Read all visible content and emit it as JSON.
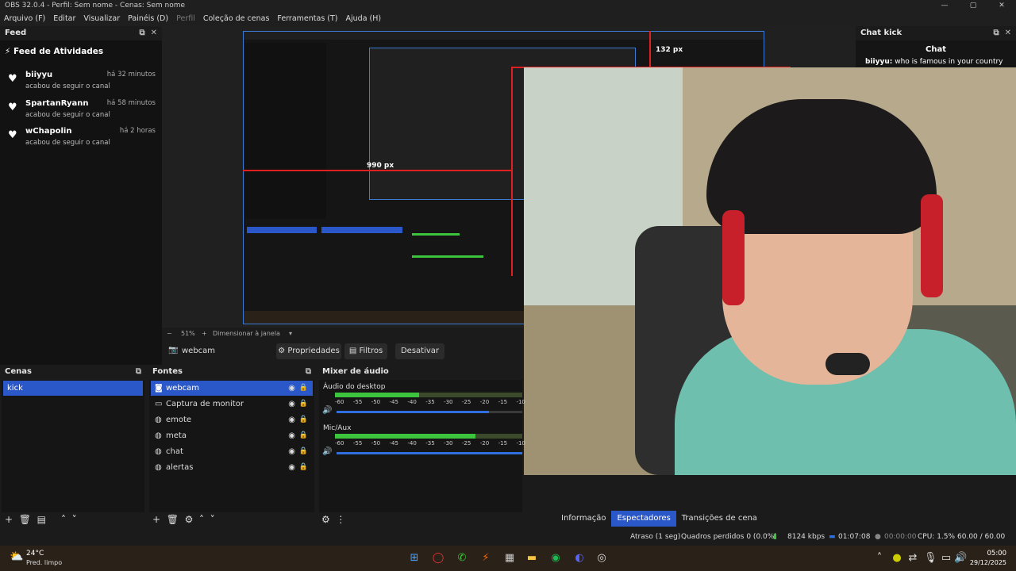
{
  "window": {
    "title": "OBS 32.0.4 - Perfil: Sem nome - Cenas: Sem nome",
    "minimize": "—",
    "maximize": "▢",
    "close": "✕"
  },
  "menu": [
    "Arquivo (F)",
    "Editar",
    "Visualizar",
    "Painéis (D)",
    "Perfil",
    "Coleção de cenas",
    "Ferramentas (T)",
    "Ajuda (H)"
  ],
  "feed": {
    "dock_title": "Feed",
    "heading": "Feed de Atividades",
    "items": [
      {
        "name": "biiyyu",
        "time": "há 32 minutos",
        "action": "acabou de seguir o canal"
      },
      {
        "name": "SpartanRyann",
        "time": "há 58 minutos",
        "action": "acabou de seguir o canal"
      },
      {
        "name": "wChapolin",
        "time": "há 2 horas",
        "action": "acabou de seguir o canal"
      }
    ]
  },
  "chat": {
    "dock_title": "Chat kick",
    "heading": "Chat",
    "messages": [
      {
        "user": "biiyyu:",
        "text": "who is famous in your country"
      }
    ]
  },
  "overlay": {
    "label_top": "132 px",
    "label_left": "990 px"
  },
  "zoom": {
    "minus": "−",
    "value": "51%",
    "plus": "+",
    "mode": "Dimensionar à janela"
  },
  "source_bar": {
    "source": "webcam",
    "properties": "Propriedades",
    "filters": "Filtros",
    "deactivate": "Desativar"
  },
  "scenes": {
    "title": "Cenas",
    "items": [
      "kick"
    ]
  },
  "sources": {
    "title": "Fontes",
    "items": [
      {
        "label": "webcam",
        "icon": "camera-icon"
      },
      {
        "label": "Captura de monitor",
        "icon": "monitor-icon"
      },
      {
        "label": "emote",
        "icon": "globe-icon"
      },
      {
        "label": "meta",
        "icon": "globe-icon"
      },
      {
        "label": "chat",
        "icon": "globe-icon"
      },
      {
        "label": "alertas",
        "icon": "globe-icon"
      }
    ]
  },
  "mixer": {
    "title": "Mixer de áudio",
    "channels": [
      {
        "name": "Áudio do desktop",
        "level": 0.45,
        "volume": 0.82
      },
      {
        "name": "Mic/Aux",
        "level": 0.75,
        "volume": 1.0
      }
    ],
    "scale": [
      "-60",
      "-55",
      "-50",
      "-45",
      "-40",
      "-35",
      "-30",
      "-25",
      "-20",
      "-15",
      "-10"
    ]
  },
  "tabs": [
    "Informação",
    "Espectadores",
    "Transições de cena"
  ],
  "status": {
    "delay": "Atraso (1 seg)",
    "dropped": "Quadros perdidos 0 (0.0%)",
    "bitrate": "8124 kbps",
    "live_time": "01:07:08",
    "rec_time": "00:00:00",
    "cpu": "CPU: 1.5%",
    "fps": "60.00 / 60.00 FPS"
  },
  "taskbar": {
    "weather_temp": "24°C",
    "weather_desc": "Pred. limpo",
    "time": "05:00",
    "date": "29/12/2025"
  },
  "colors": {
    "accent": "#2a58c8",
    "meter": "#3cc43c",
    "guide": "#e02020"
  }
}
